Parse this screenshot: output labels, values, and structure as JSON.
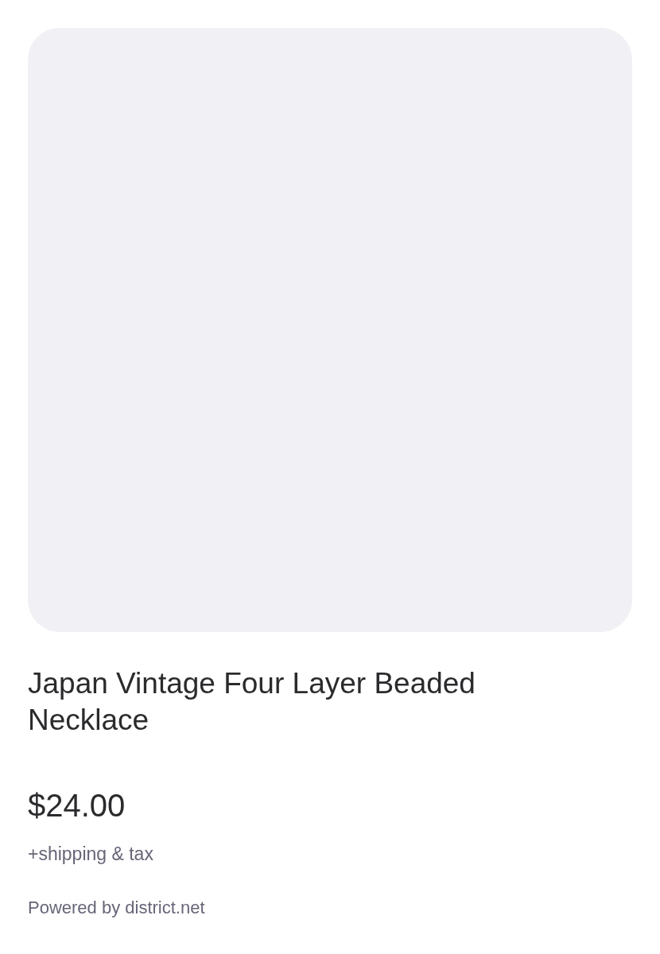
{
  "product": {
    "title": "Japan Vintage Four Layer Beaded Necklace",
    "price": "$24.00",
    "price_note": "+shipping & tax"
  },
  "footer": {
    "powered_by": "Powered by district.net"
  }
}
